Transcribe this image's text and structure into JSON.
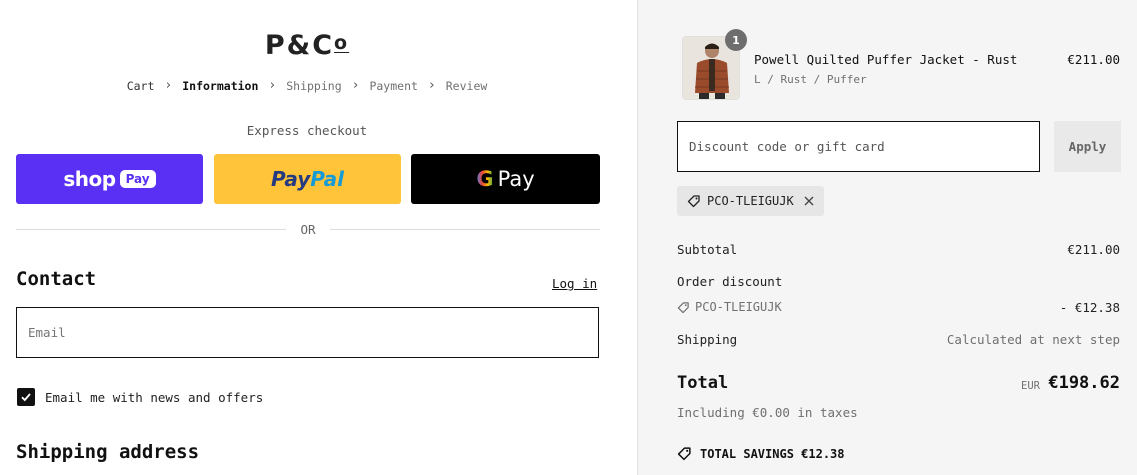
{
  "brand": {
    "logo_main": "P&C",
    "logo_sub": "o"
  },
  "breadcrumb": {
    "items": [
      {
        "label": "Cart",
        "state": "link"
      },
      {
        "label": "Information",
        "state": "active"
      },
      {
        "label": "Shipping",
        "state": "inactive"
      },
      {
        "label": "Payment",
        "state": "inactive"
      },
      {
        "label": "Review",
        "state": "inactive"
      }
    ],
    "separator": "›"
  },
  "express": {
    "title": "Express checkout",
    "shop_pay": {
      "word": "shop",
      "pill": "Pay",
      "color": "#5a31f4"
    },
    "paypal": {
      "part1": "Pay",
      "part2": "Pal",
      "color": "#ffc439"
    },
    "gpay": {
      "g": "G",
      "label": "Pay",
      "color": "#000000"
    },
    "or": "OR"
  },
  "contact": {
    "heading": "Contact",
    "login": "Log in",
    "email_placeholder": "Email",
    "newsletter_label": "Email me with news and offers",
    "newsletter_checked": true
  },
  "shipping": {
    "heading": "Shipping address"
  },
  "order": {
    "item": {
      "name": "Powell Quilted Puffer Jacket - Rust",
      "variant": "L / Rust / Puffer",
      "price": "€211.00",
      "quantity": "1"
    },
    "discount_placeholder": "Discount code or gift card",
    "apply_label": "Apply",
    "applied_code": "PCO-TLEIGUJK",
    "subtotal_label": "Subtotal",
    "subtotal_value": "€211.00",
    "order_discount_label": "Order discount",
    "discount_code": "PCO-TLEIGUJK",
    "discount_value": "- €12.38",
    "shipping_label": "Shipping",
    "shipping_value": "Calculated at next step",
    "total_label": "Total",
    "total_currency": "EUR",
    "total_value": "€198.62",
    "taxes_note": "Including €0.00 in taxes",
    "savings": "TOTAL SAVINGS €12.38"
  }
}
